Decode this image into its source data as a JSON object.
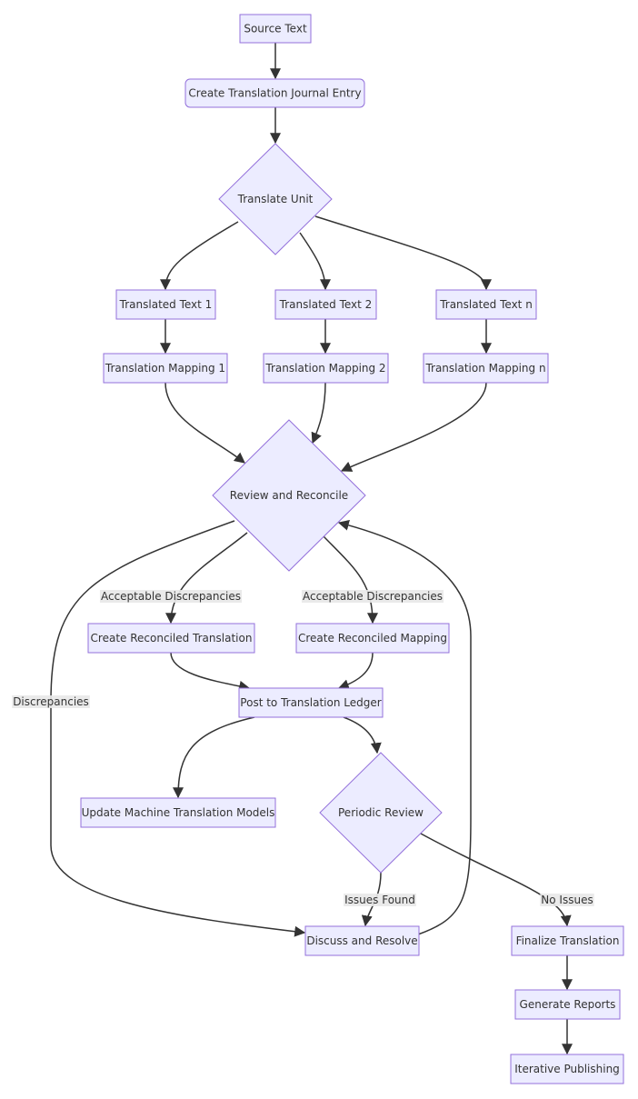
{
  "diagram": {
    "type": "flowchart",
    "direction": "top-down",
    "colors": {
      "node_fill": "#ECECFF",
      "node_stroke": "#9370DB",
      "text": "#333333",
      "edge": "#333333",
      "edge_label_bg": "#E8E8E8"
    },
    "nodes": [
      {
        "id": "src",
        "label": "Source Text",
        "shape": "rect"
      },
      {
        "id": "journal",
        "label": "Create Translation Journal Entry",
        "shape": "rounded"
      },
      {
        "id": "unit",
        "label": "Translate Unit",
        "shape": "diamond"
      },
      {
        "id": "t1",
        "label": "Translated Text 1",
        "shape": "rect"
      },
      {
        "id": "t2",
        "label": "Translated Text 2",
        "shape": "rect"
      },
      {
        "id": "tn",
        "label": "Translated Text n",
        "shape": "rect"
      },
      {
        "id": "m1",
        "label": "Translation Mapping 1",
        "shape": "rect"
      },
      {
        "id": "m2",
        "label": "Translation Mapping 2",
        "shape": "rect"
      },
      {
        "id": "mn",
        "label": "Translation Mapping n",
        "shape": "rect"
      },
      {
        "id": "review",
        "label": "Review and Reconcile",
        "shape": "diamond"
      },
      {
        "id": "crt",
        "label": "Create Reconciled Translation",
        "shape": "rect"
      },
      {
        "id": "crm",
        "label": "Create Reconciled Mapping",
        "shape": "rect"
      },
      {
        "id": "post",
        "label": "Post to Translation Ledger",
        "shape": "rect"
      },
      {
        "id": "update",
        "label": "Update Machine Translation Models",
        "shape": "rect"
      },
      {
        "id": "periodic",
        "label": "Periodic Review",
        "shape": "diamond"
      },
      {
        "id": "discuss",
        "label": "Discuss and Resolve",
        "shape": "rect"
      },
      {
        "id": "final",
        "label": "Finalize Translation",
        "shape": "rect"
      },
      {
        "id": "reports",
        "label": "Generate Reports",
        "shape": "rect"
      },
      {
        "id": "publish",
        "label": "Iterative Publishing",
        "shape": "rect"
      }
    ],
    "edges": [
      {
        "from": "src",
        "to": "journal",
        "label": ""
      },
      {
        "from": "journal",
        "to": "unit",
        "label": ""
      },
      {
        "from": "unit",
        "to": "t1",
        "label": ""
      },
      {
        "from": "unit",
        "to": "t2",
        "label": ""
      },
      {
        "from": "unit",
        "to": "tn",
        "label": ""
      },
      {
        "from": "t1",
        "to": "m1",
        "label": ""
      },
      {
        "from": "t2",
        "to": "m2",
        "label": ""
      },
      {
        "from": "tn",
        "to": "mn",
        "label": ""
      },
      {
        "from": "m1",
        "to": "review",
        "label": ""
      },
      {
        "from": "m2",
        "to": "review",
        "label": ""
      },
      {
        "from": "mn",
        "to": "review",
        "label": ""
      },
      {
        "from": "review",
        "to": "crt",
        "label": "Acceptable Discrepancies"
      },
      {
        "from": "review",
        "to": "crm",
        "label": "Acceptable Discrepancies"
      },
      {
        "from": "review",
        "to": "discuss",
        "label": "Discrepancies"
      },
      {
        "from": "crt",
        "to": "post",
        "label": ""
      },
      {
        "from": "crm",
        "to": "post",
        "label": ""
      },
      {
        "from": "post",
        "to": "update",
        "label": ""
      },
      {
        "from": "post",
        "to": "periodic",
        "label": ""
      },
      {
        "from": "periodic",
        "to": "discuss",
        "label": "Issues Found"
      },
      {
        "from": "periodic",
        "to": "final",
        "label": "No Issues"
      },
      {
        "from": "discuss",
        "to": "review",
        "label": ""
      },
      {
        "from": "final",
        "to": "reports",
        "label": ""
      },
      {
        "from": "reports",
        "to": "publish",
        "label": ""
      }
    ]
  }
}
